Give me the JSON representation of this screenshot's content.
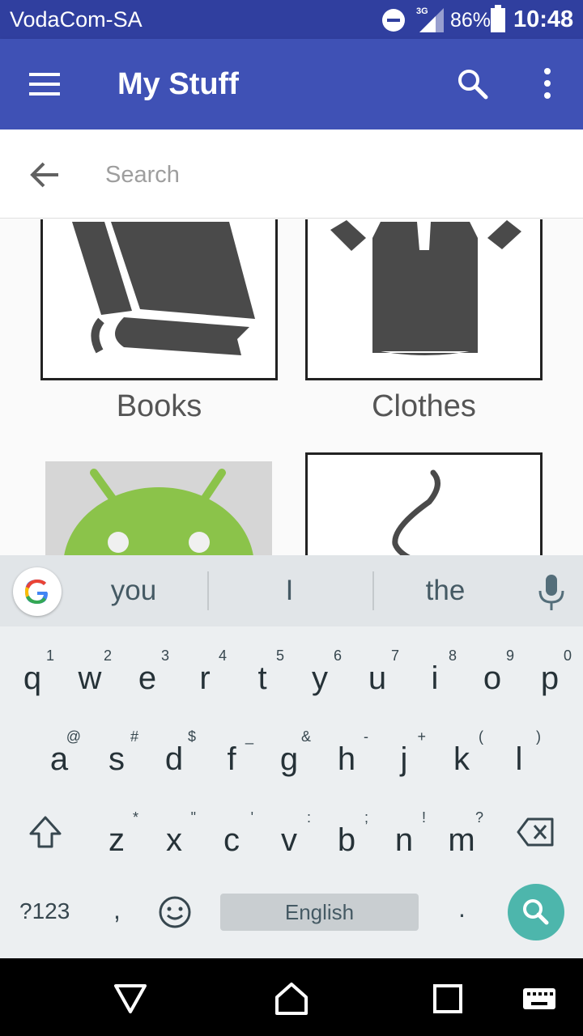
{
  "status_bar": {
    "carrier": "VodaCom-SA",
    "network_type": "3G",
    "battery": "86%",
    "time": "10:48"
  },
  "app_bar": {
    "title": "My Stuff"
  },
  "search": {
    "placeholder": "Search",
    "value": ""
  },
  "categories": [
    {
      "label": "Books"
    },
    {
      "label": "Clothes"
    }
  ],
  "keyboard": {
    "suggestions": [
      "you",
      "I",
      "the"
    ],
    "row1": [
      {
        "key": "q",
        "alt": "1"
      },
      {
        "key": "w",
        "alt": "2"
      },
      {
        "key": "e",
        "alt": "3"
      },
      {
        "key": "r",
        "alt": "4"
      },
      {
        "key": "t",
        "alt": "5"
      },
      {
        "key": "y",
        "alt": "6"
      },
      {
        "key": "u",
        "alt": "7"
      },
      {
        "key": "i",
        "alt": "8"
      },
      {
        "key": "o",
        "alt": "9"
      },
      {
        "key": "p",
        "alt": "0"
      }
    ],
    "row2": [
      {
        "key": "a",
        "alt": "@"
      },
      {
        "key": "s",
        "alt": "#"
      },
      {
        "key": "d",
        "alt": "$"
      },
      {
        "key": "f",
        "alt": "_"
      },
      {
        "key": "g",
        "alt": "&"
      },
      {
        "key": "h",
        "alt": "-"
      },
      {
        "key": "j",
        "alt": "+"
      },
      {
        "key": "k",
        "alt": "("
      },
      {
        "key": "l",
        "alt": ")"
      }
    ],
    "row3": [
      {
        "key": "z",
        "alt": "*"
      },
      {
        "key": "x",
        "alt": "\""
      },
      {
        "key": "c",
        "alt": "'"
      },
      {
        "key": "v",
        "alt": ":"
      },
      {
        "key": "b",
        "alt": ";"
      },
      {
        "key": "n",
        "alt": "!"
      },
      {
        "key": "m",
        "alt": "?"
      }
    ],
    "symbols_key": "?123",
    "comma_key": ",",
    "period_key": ".",
    "space_label": "English"
  },
  "colors": {
    "status_bar": "#303f9f",
    "app_bar": "#3f51b5",
    "keyboard_bg": "#eceff1",
    "search_key": "#4db6ac",
    "android_green": "#8bc34a"
  },
  "icons": {
    "menu": "hamburger-menu-icon",
    "search": "search-icon",
    "overflow": "more-vert-icon",
    "back": "arrow-back-icon",
    "mic": "mic-icon",
    "backspace": "backspace-icon",
    "shift": "shift-icon",
    "emoji": "emoji-icon"
  }
}
